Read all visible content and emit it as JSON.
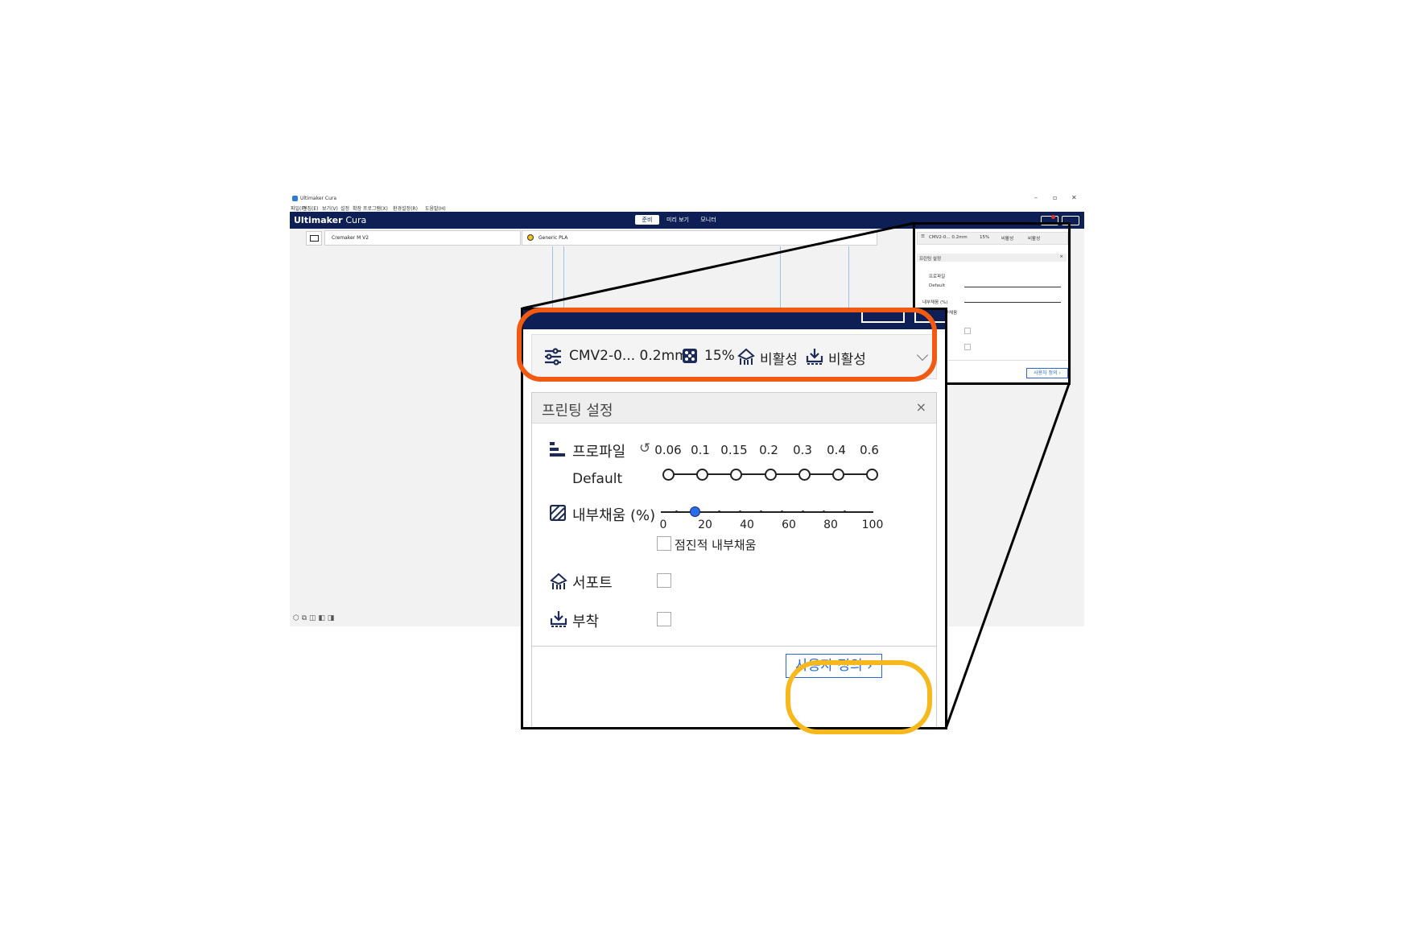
{
  "app": {
    "window_title": "Ultimaker Cura",
    "menu": [
      "파일(F)",
      "편집(E)",
      "보기(V)",
      "설정",
      "확장 프로그램(X)",
      "환경설정(R)",
      "도움말(H)"
    ],
    "brand": "Ultimaker",
    "brand_suffix": "Cura",
    "stage_tabs": [
      "준비",
      "미리 보기",
      "모니터"
    ],
    "printer": "Cremaker M V2",
    "material": "Generic PLA",
    "window_controls": [
      "–",
      "▫",
      "✕"
    ]
  },
  "summary": {
    "profile": "CMV2-0... 0.2mm",
    "infill": "15%",
    "support": "비활성",
    "adhesion": "비활성"
  },
  "mini_summary": {
    "profile": "CMV2-0... 0.2mm",
    "infill": "15%",
    "support": "비활성",
    "adhesion": "비활성"
  },
  "panel": {
    "title": "프린팅 설정",
    "close": "×",
    "profile_label": "프로파일",
    "profile_value": "Default",
    "layer_heights": [
      "0.06",
      "0.1",
      "0.15",
      "0.2",
      "0.3",
      "0.4",
      "0.6"
    ],
    "infill_label": "내부채움 (%)",
    "infill_ticks": [
      "0",
      "20",
      "40",
      "60",
      "80",
      "100"
    ],
    "infill_value_percent": 15,
    "gradual_infill_label": "점진적 내부채움",
    "support_label": "서포트",
    "adhesion_label": "부착",
    "custom_button": "사용자 정의 ›"
  },
  "colors": {
    "header_navy": "#0d1f55",
    "accent_blue": "#2a6ad0",
    "highlight_orange": "#f25a12",
    "highlight_yellow": "#f6b81d"
  }
}
